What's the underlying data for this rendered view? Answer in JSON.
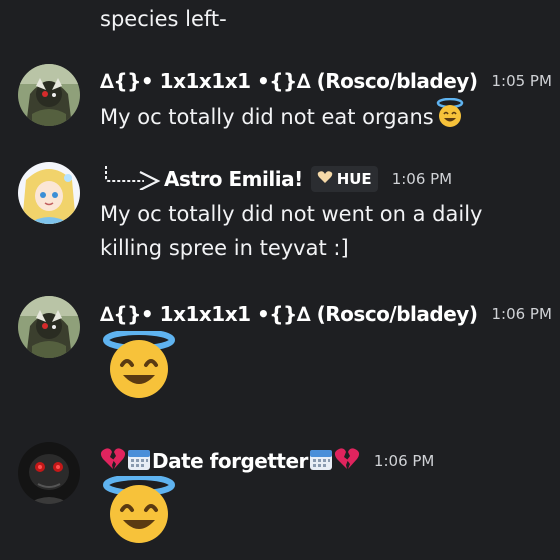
{
  "messages": [
    {
      "continuation": "species left-"
    },
    {
      "username": "∆{}• 1x1x1x1 •{}∆ (Rosco/bladey)",
      "timestamp": "1:05 PM",
      "content": "My oc totally did not eat organs",
      "emoji": "smiling-face-with-halo"
    },
    {
      "username": "Astro Emilia!",
      "tag": "HUE",
      "timestamp": "1:06 PM",
      "content_lines": [
        "My oc totally did not went on a daily",
        "killing spree in teyvat :]"
      ]
    },
    {
      "username": "∆{}• 1x1x1x1 •{}∆ (Rosco/bladey)",
      "timestamp": "1:06 PM",
      "emoji": "smiling-face-with-halo"
    },
    {
      "username": "Date forgetter",
      "timestamp": "1:06 PM",
      "emoji": "smiling-face-with-halo"
    }
  ],
  "icons": {
    "reply": "reply-arrow-icon",
    "broken_heart": "broken-heart-icon",
    "calendar": "calendar-icon",
    "tag_heart": "heart-icon",
    "halo": "smiling-face-with-halo-icon"
  },
  "colors": {
    "background": "#1e1f22",
    "text": "#f2f3f5",
    "timestamp": "#d0d2d6",
    "tag_bg": "#2b2d31",
    "broken_heart": "#e0245e",
    "calendar_blue": "#4a8fd9",
    "emoji_yellow": "#f7c23a",
    "halo_blue": "#5fb3f0"
  }
}
